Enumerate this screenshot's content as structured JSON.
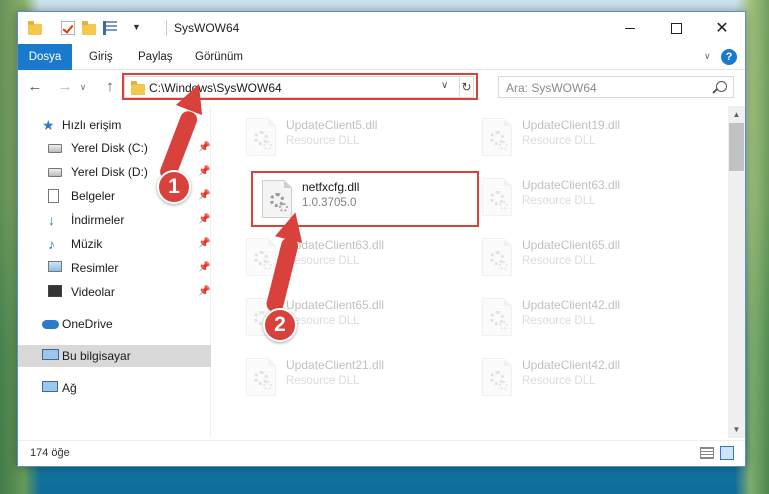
{
  "window": {
    "title": "SysWOW64"
  },
  "ribbon": {
    "tabs": [
      "Dosya",
      "Giriş",
      "Paylaş",
      "Görünüm"
    ],
    "help": "?"
  },
  "address": {
    "path": "C:\\Windows\\SysWOW64",
    "search_placeholder": "Ara: SysWOW64"
  },
  "sidebar": {
    "quick_access": "Hızlı erişim",
    "items": [
      {
        "label": "Yerel Disk (C:)",
        "icon": "drive-icon",
        "pinned": true
      },
      {
        "label": "Yerel Disk (D:)",
        "icon": "drive-icon",
        "pinned": true
      },
      {
        "label": "Belgeler",
        "icon": "documents-icon",
        "pinned": true
      },
      {
        "label": "İndirmeler",
        "icon": "downloads-icon",
        "pinned": true
      },
      {
        "label": "Müzik",
        "icon": "music-icon",
        "pinned": true
      },
      {
        "label": "Resimler",
        "icon": "pictures-icon",
        "pinned": true
      },
      {
        "label": "Videolar",
        "icon": "videos-icon",
        "pinned": true
      }
    ],
    "onedrive": "OneDrive",
    "this_pc": "Bu bilgisayar",
    "network": "Ağ"
  },
  "files": [
    {
      "name": "UpdateClient5.dll",
      "desc": "Resource DLL",
      "faded": true
    },
    {
      "name": "UpdateClient19.dll",
      "desc": "Resource DLL",
      "faded": true
    },
    {
      "name": "netfxcfg.dll",
      "desc": "1.0.3705.0",
      "faded": false
    },
    {
      "name": "UpdateClient63.dll",
      "desc": "Resource DLL",
      "faded": true
    },
    {
      "name": "UpdateClient63.dll",
      "desc": "Resource DLL",
      "faded": true
    },
    {
      "name": "UpdateClient65.dll",
      "desc": "Resource DLL",
      "faded": true
    },
    {
      "name": "UpdateClient65.dll",
      "desc": "Resource DLL",
      "faded": true
    },
    {
      "name": "UpdateClient42.dll",
      "desc": "Resource DLL",
      "faded": true
    },
    {
      "name": "UpdateClient21.dll",
      "desc": "Resource DLL",
      "faded": true
    },
    {
      "name": "UpdateClient42.dll",
      "desc": "Resource DLL",
      "faded": true
    }
  ],
  "status": {
    "count": "174 öğe"
  },
  "annotations": {
    "step1": "1",
    "step2": "2",
    "color": "#d9413c"
  },
  "colors": {
    "accent": "#1979ca",
    "highlight": "#d9413c"
  }
}
